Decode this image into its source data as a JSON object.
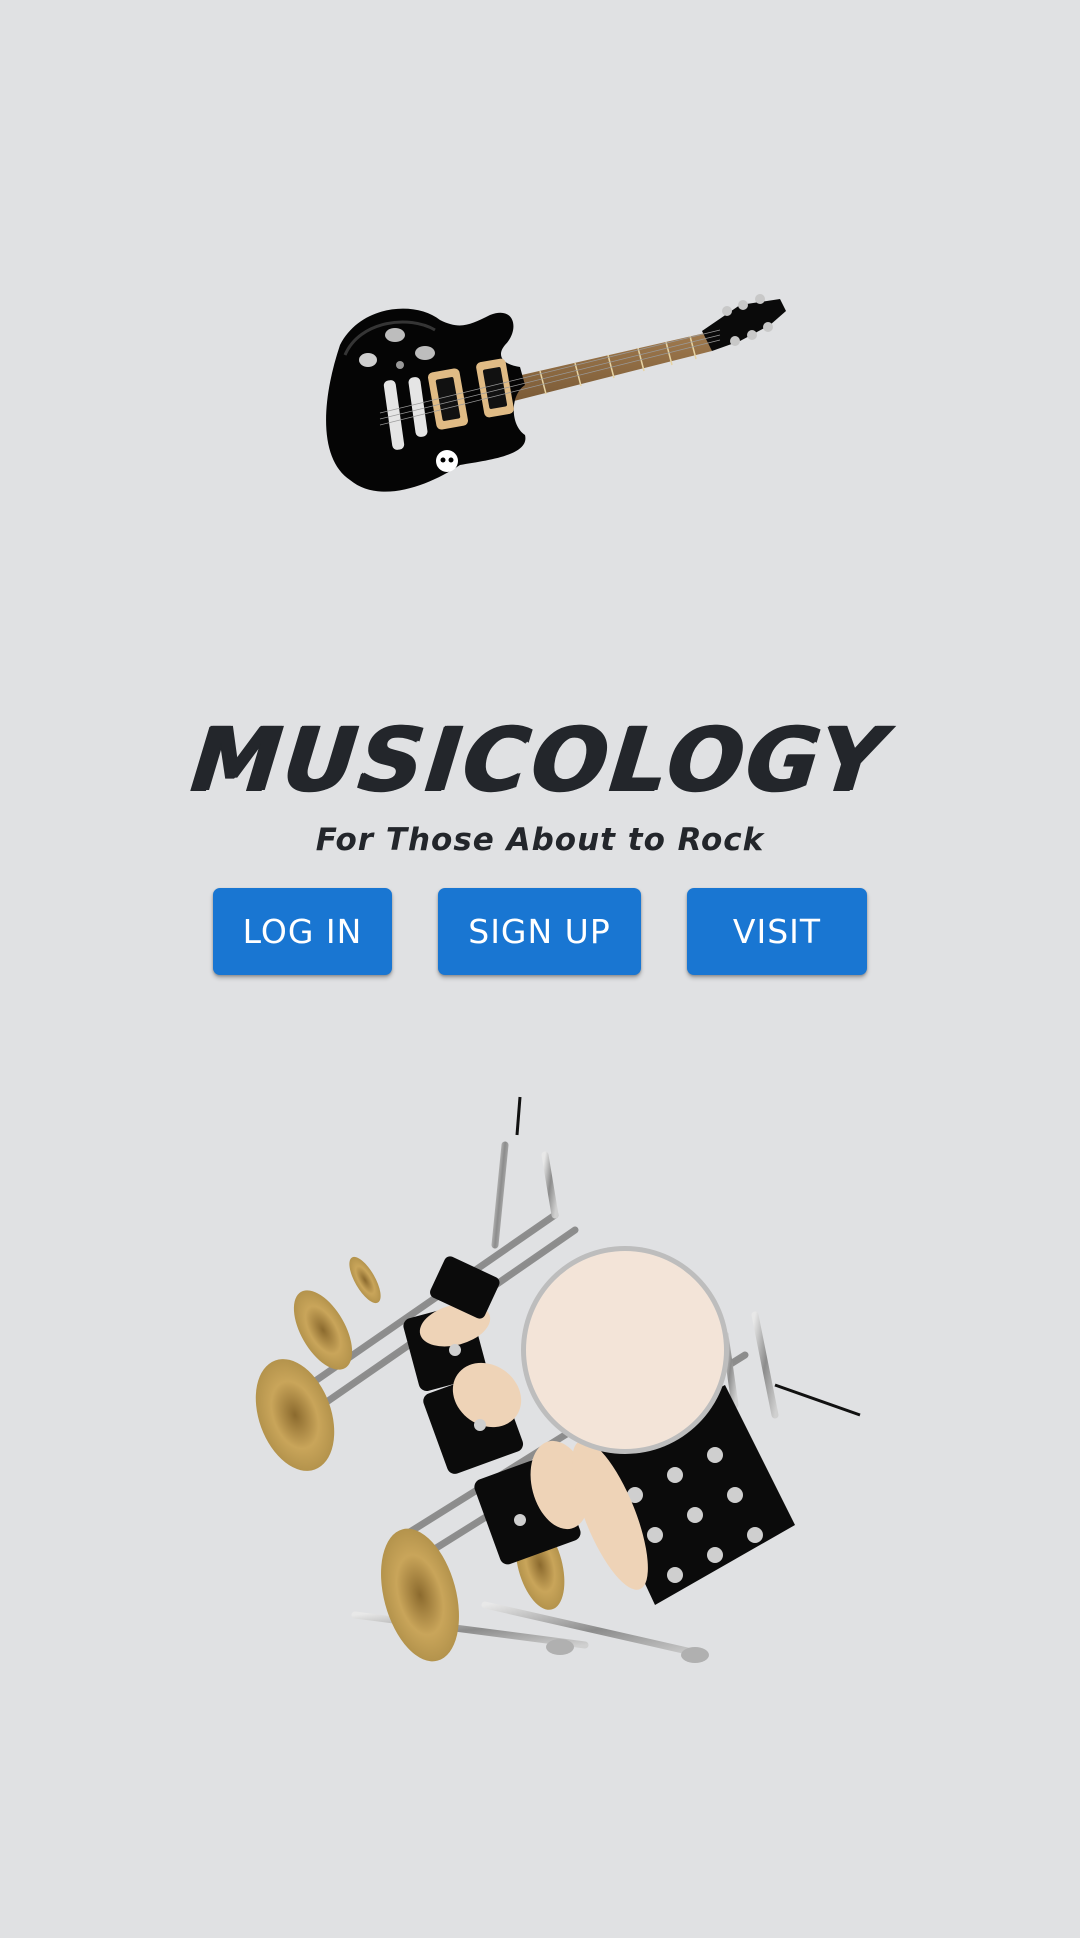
{
  "app": {
    "title": "MUSICOLOGY",
    "tagline": "For Those About to Rock"
  },
  "actions": {
    "login_label": "LOG IN",
    "signup_label": "SIGN UP",
    "visit_label": "VISIT"
  },
  "images": {
    "top_illustration": "electric-guitar",
    "bottom_illustration": "drum-kit"
  },
  "colors": {
    "background": "#e0e1e3",
    "button": "#1976d2",
    "button_text": "#ffffff",
    "title_text": "#23262b"
  }
}
